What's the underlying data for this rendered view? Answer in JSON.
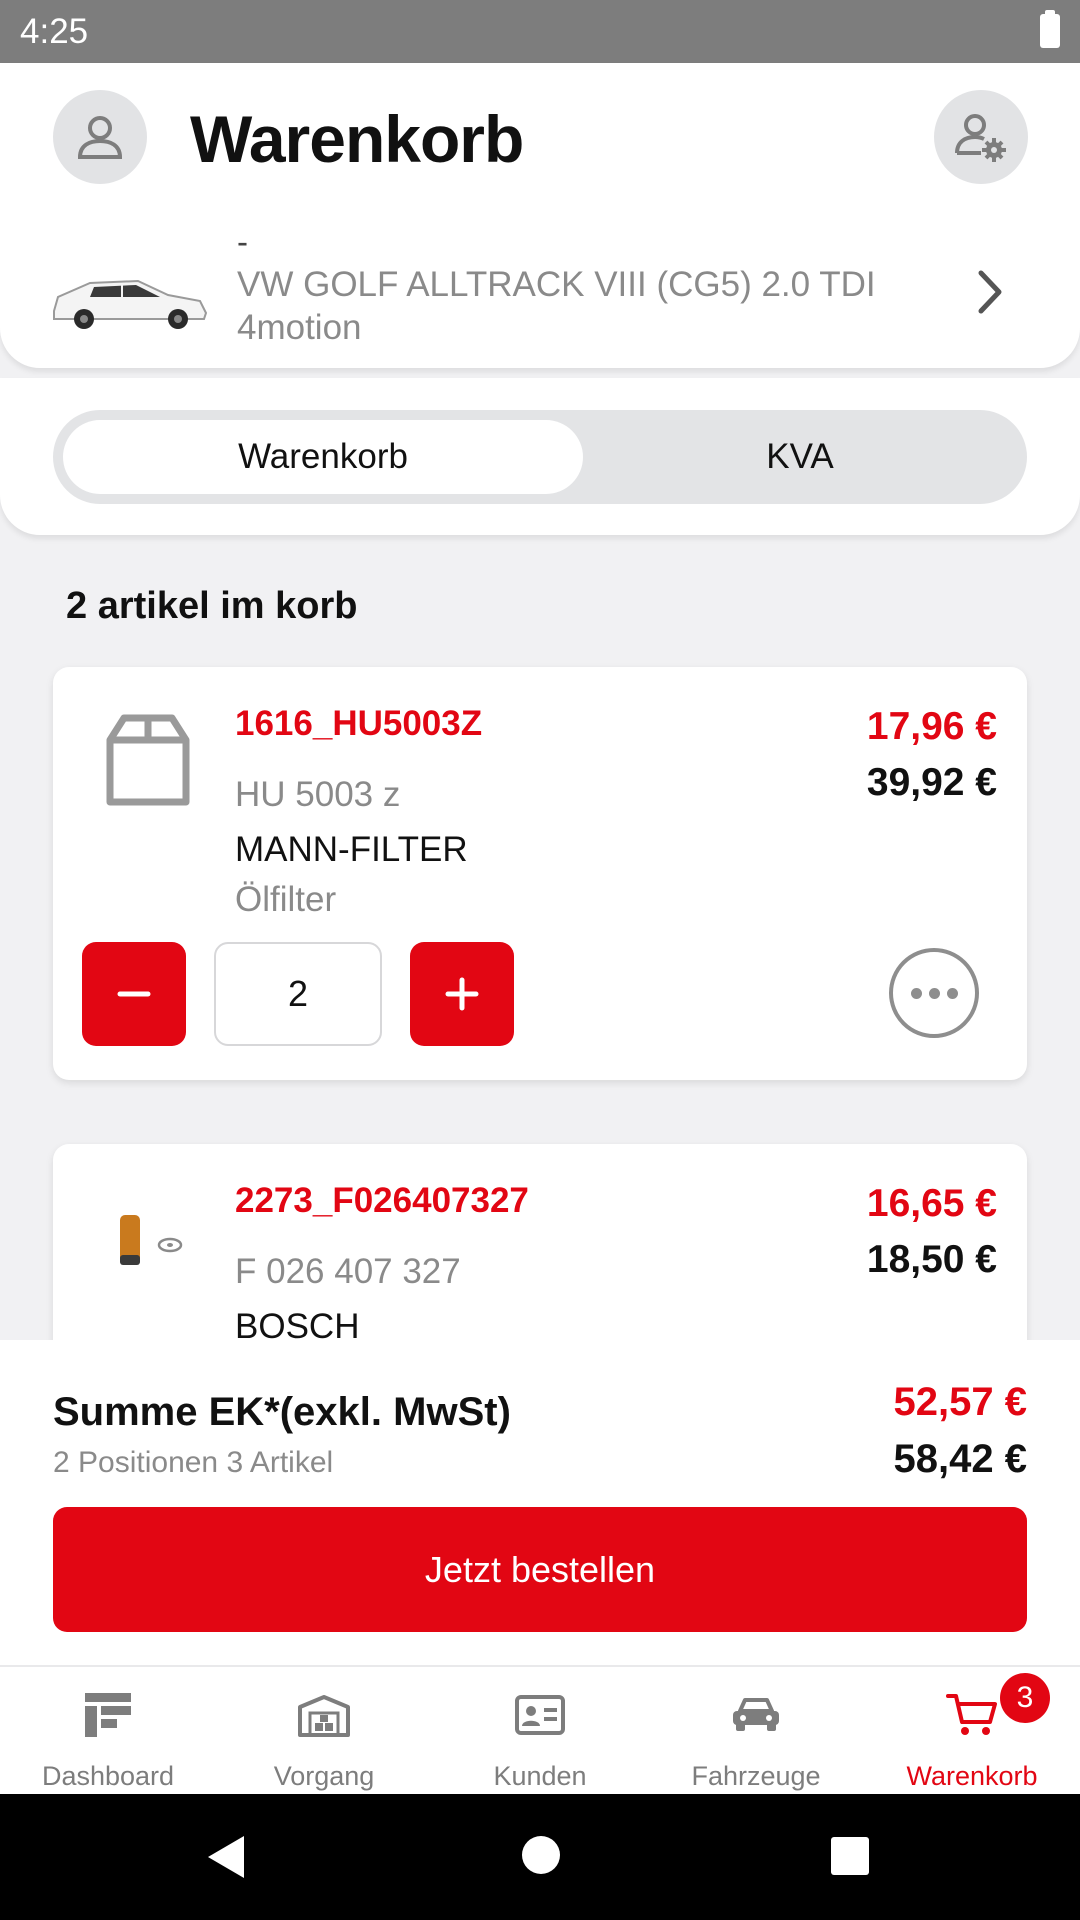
{
  "status_bar": {
    "time": "4:25"
  },
  "header": {
    "title": "Warenkorb",
    "vehicle": {
      "line1": "-",
      "name": "VW GOLF ALLTRACK VIII (CG5) 2.0 TDI 4motion"
    }
  },
  "tabs": {
    "active": "Warenkorb",
    "inactive": "KVA"
  },
  "cart": {
    "count_label": "2 artikel im korb",
    "items": [
      {
        "id": "1616_HU5003Z",
        "ref": "HU 5003 z",
        "brand": "MANN-FILTER",
        "type": "Ölfilter",
        "price_net": "17,96 €",
        "price_gross": "39,92 €",
        "quantity": "2"
      },
      {
        "id": "2273_F026407327",
        "ref": "F 026 407 327",
        "brand": "BOSCH",
        "price_net": "16,65 €",
        "price_gross": "18,50 €"
      }
    ]
  },
  "summary": {
    "label": "Summe EK*(exkl. MwSt)",
    "sub": "2 Positionen 3 Artikel",
    "total_net": "52,57 €",
    "total_gross": "58,42 €",
    "order_button": "Jetzt bestellen"
  },
  "bottom_nav": {
    "items": [
      {
        "label": "Dashboard",
        "icon": "dashboard-icon"
      },
      {
        "label": "Vorgang",
        "icon": "warehouse-icon"
      },
      {
        "label": "Kunden",
        "icon": "contact-card-icon"
      },
      {
        "label": "Fahrzeuge",
        "icon": "car-icon"
      },
      {
        "label": "Warenkorb",
        "icon": "cart-icon"
      }
    ],
    "cart_badge": "3"
  },
  "colors": {
    "accent": "#e20613",
    "muted": "#8a8a8a",
    "background": "#f1f1f3"
  }
}
